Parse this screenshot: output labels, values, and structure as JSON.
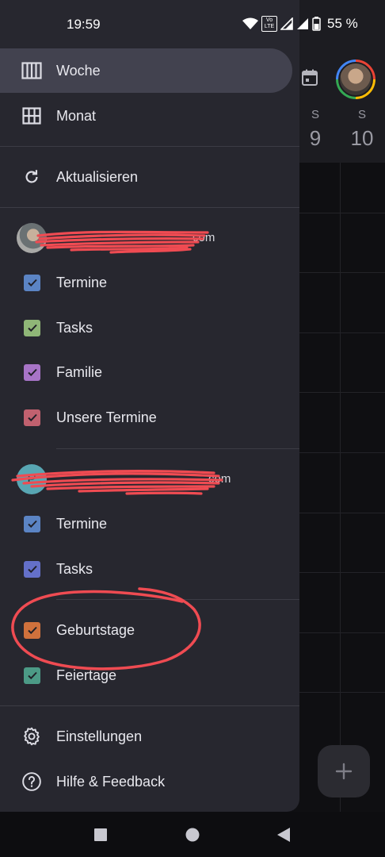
{
  "status_bar": {
    "time": "19:59",
    "battery": "55 %",
    "volte_label": "Vo LTE"
  },
  "background": {
    "days": [
      {
        "letter": "S",
        "number": "9"
      },
      {
        "letter": "S",
        "number": "10"
      }
    ]
  },
  "drawer": {
    "views": [
      {
        "label": "Woche",
        "icon": "week-view-icon",
        "active": true
      },
      {
        "label": "Monat",
        "icon": "month-view-icon",
        "active": false
      }
    ],
    "refresh_label": "Aktualisieren",
    "accounts": [
      {
        "email_visible": "com",
        "avatar_letter": "",
        "calendars": [
          {
            "label": "Termine",
            "color": "#5b84c4"
          },
          {
            "label": "Tasks",
            "color": "#8fb677"
          },
          {
            "label": "Familie",
            "color": "#a774c7"
          },
          {
            "label": "Unsere Termine",
            "color": "#c1616f"
          }
        ]
      },
      {
        "email_visible": "com",
        "avatar_letter": "P",
        "calendars": [
          {
            "label": "Termine",
            "color": "#5b84c4"
          },
          {
            "label": "Tasks",
            "color": "#6470c9"
          }
        ]
      }
    ],
    "other_calendars": [
      {
        "label": "Geburtstage",
        "color": "#d0713c"
      },
      {
        "label": "Feiertage",
        "color": "#4c9a86"
      }
    ],
    "settings_label": "Einstellungen",
    "help_label": "Hilfe & Feedback"
  },
  "colors": {
    "drawer_bg": "#27272f",
    "active_item_bg": "#42424f",
    "annotation_red": "#ef4b52"
  }
}
